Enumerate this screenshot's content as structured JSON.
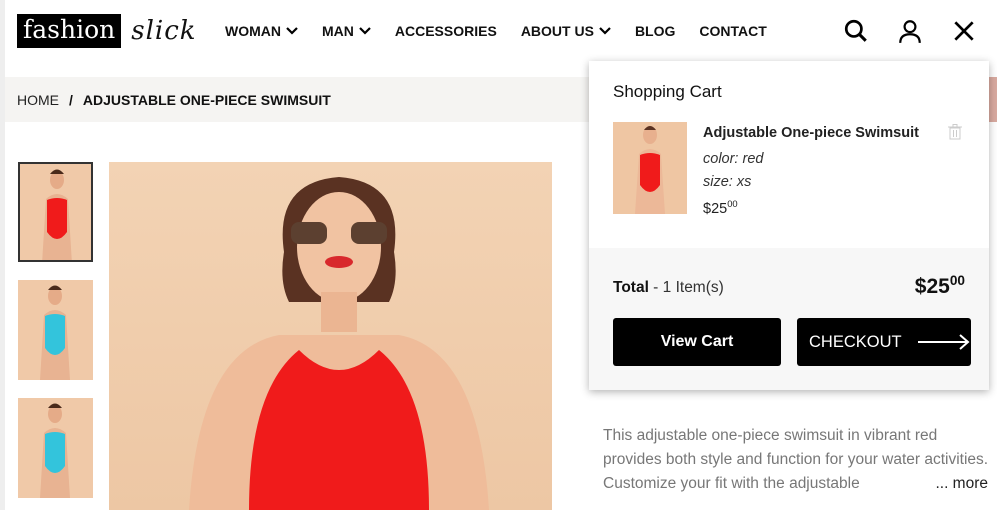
{
  "logo": {
    "part1": "fashion",
    "part2": "slick"
  },
  "nav": [
    {
      "label": "WOMAN",
      "dropdown": true
    },
    {
      "label": "MAN",
      "dropdown": true
    },
    {
      "label": "ACCESSORIES",
      "dropdown": false
    },
    {
      "label": "ABOUT US",
      "dropdown": true
    },
    {
      "label": "BLOG",
      "dropdown": false
    },
    {
      "label": "CONTACT",
      "dropdown": false
    }
  ],
  "header_icons": [
    "search-icon",
    "user-icon",
    "close-icon"
  ],
  "breadcrumb": {
    "home": "HOME",
    "separator": "/",
    "current": "ADJUSTABLE ONE-PIECE SWIMSUIT"
  },
  "gallery": {
    "thumbnails": [
      {
        "swimsuit_color": "#f01b1b",
        "selected": true
      },
      {
        "swimsuit_color": "#33c4dc",
        "selected": false
      },
      {
        "swimsuit_color": "#33c4dc",
        "selected": false
      }
    ]
  },
  "description": {
    "text": "This adjustable one-piece swimsuit in vibrant red provides both style and function for your water activities. Customize your fit with the adjustable",
    "more": "... more"
  },
  "cart": {
    "title": "Shopping Cart",
    "item": {
      "name": "Adjustable One-piece Swimsuit",
      "color": "color: red",
      "size": "size: xs",
      "price_main": "$25",
      "price_cents": "00"
    },
    "total_label": "Total",
    "total_count": " - 1 Item(s)",
    "total_main": "$25",
    "total_cents": "00",
    "view_cart": "View Cart",
    "checkout": "CHECKOUT"
  }
}
